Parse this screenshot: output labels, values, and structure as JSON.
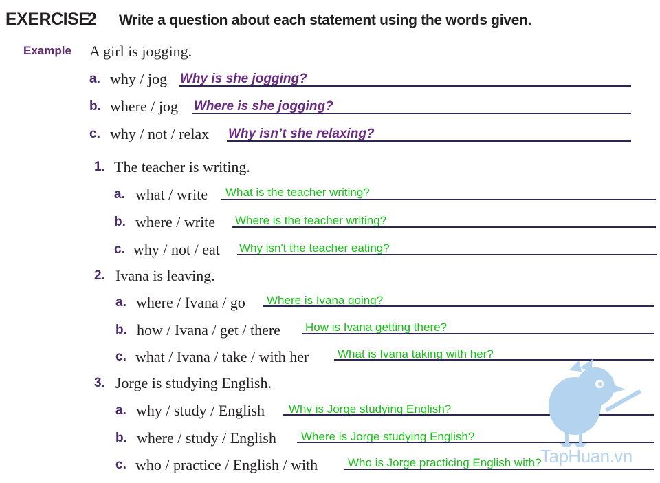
{
  "header": {
    "exercise_label": "EXERCISE",
    "exercise_number": "2",
    "instruction": "Write a question about each statement using the words given."
  },
  "example": {
    "label": "Example",
    "statement": "A girl is jogging.",
    "items": [
      {
        "letter": "a.",
        "prompt": "why / jog",
        "answer": "Why is she jogging?"
      },
      {
        "letter": "b.",
        "prompt": "where / jog",
        "answer": "Where is she jogging?"
      },
      {
        "letter": "c.",
        "prompt": "why / not / relax",
        "answer": "Why isn’t she relaxing?"
      }
    ]
  },
  "questions": [
    {
      "number": "1.",
      "statement": "The teacher is writing.",
      "items": [
        {
          "letter": "a.",
          "prompt": "what / write",
          "answer": "What is the teacher writing?"
        },
        {
          "letter": "b.",
          "prompt": "where / write",
          "answer": "Where is the teacher writing?"
        },
        {
          "letter": "c.",
          "prompt": "why / not / eat",
          "answer": "Why isn't the teacher eating?"
        }
      ]
    },
    {
      "number": "2.",
      "statement": "Ivana is leaving.",
      "items": [
        {
          "letter": "a.",
          "prompt": "where / Ivana / go",
          "answer": "Where is Ivana going?"
        },
        {
          "letter": "b.",
          "prompt": "how / Ivana / get / there",
          "answer": "How is Ivana getting there?"
        },
        {
          "letter": "c.",
          "prompt": "what / Ivana / take / with her",
          "answer": "What is Ivana taking with her?"
        }
      ]
    },
    {
      "number": "3.",
      "statement": "Jorge is studying English.",
      "items": [
        {
          "letter": "a.",
          "prompt": "why / study / English",
          "answer": "Why is Jorge studying English?"
        },
        {
          "letter": "b.",
          "prompt": "where / study / English",
          "answer": "Where is Jorge studying English?"
        },
        {
          "letter": "c.",
          "prompt": "who / practice / English / with",
          "answer": "Who is Jorge practicing English with?"
        }
      ]
    }
  ],
  "watermark": {
    "text": "TapHuan.vn",
    "icon": "bird-mascot-icon",
    "color": "#b4d3ee"
  }
}
